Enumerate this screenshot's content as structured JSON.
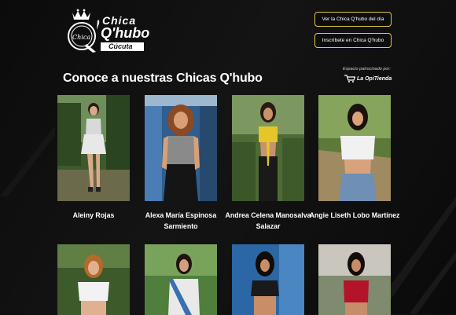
{
  "header": {
    "brand_line1": "Chica",
    "brand_line2": "Q'hubo",
    "brand_city": "Cúcuta",
    "buttons": [
      {
        "label": "Ver la Chica Q'hubo del día"
      },
      {
        "label": "Inscríbete en Chica Q'hubo"
      }
    ]
  },
  "section": {
    "title": "Conoce a nuestras Chicas Q'hubo",
    "sponsor_note": "Espacio patrocinado por:",
    "sponsor_name": "La OpiTienda"
  },
  "colors": {
    "accent": "#e3c64a",
    "background": "#0b0b0b"
  },
  "profiles": [
    {
      "name": "Aleiny Rojas"
    },
    {
      "name": "Alexa María Espinosa Sarmiento"
    },
    {
      "name": "Andrea Celena Manosalva Salazar"
    },
    {
      "name": "Angie Liseth Lobo Martínez"
    }
  ]
}
